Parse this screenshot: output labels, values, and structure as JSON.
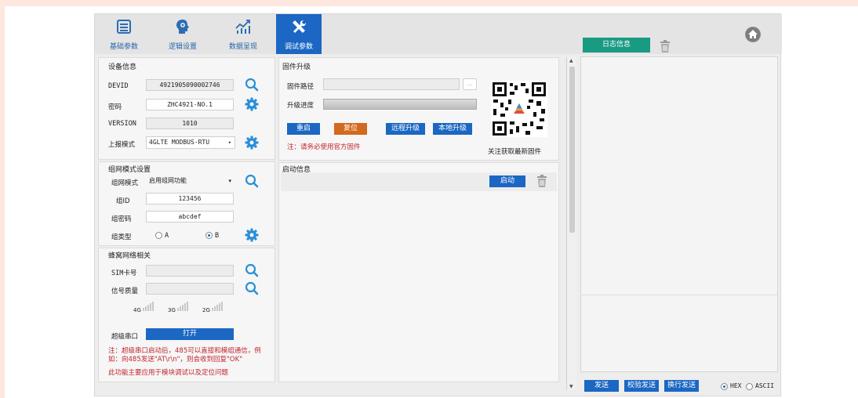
{
  "toolbar": {
    "items": [
      {
        "label": "基础参数",
        "icon": "list-icon"
      },
      {
        "label": "逻辑设置",
        "icon": "gear-brain-icon"
      },
      {
        "label": "数据呈现",
        "icon": "chart-icon"
      },
      {
        "label": "调试参数",
        "icon": "tools-icon"
      }
    ],
    "active_index": 3
  },
  "device_info": {
    "title": "设备信息",
    "devid_label": "DEVID",
    "devid_value": "4921905090002746",
    "password_label": "密码",
    "password_value": "ZHC4921-NO.1",
    "version_label": "VERSION",
    "version_value": "1010",
    "report_mode_label": "上报模式",
    "report_mode_value": "4GLTE  MODBUS-RTU"
  },
  "network_mode": {
    "title": "组网模式设置",
    "mode_label": "组网模式",
    "mode_value": "启用组网功能",
    "group_id_label": "组ID",
    "group_id_value": "123456",
    "group_pwd_label": "组密码",
    "group_pwd_value": "abcdef",
    "group_type_label": "组类型",
    "option_a": "A",
    "option_b": "B",
    "selected": "B"
  },
  "cellular": {
    "title": "蜂窝网络相关",
    "sim_label": "SIM卡号",
    "sim_value": "",
    "signal_label": "信号质量",
    "signal_value": "",
    "net_4g": "4G",
    "net_3g": "3G",
    "net_2g": "2G",
    "super_serial_label": "超级串口",
    "super_serial_button": "打开",
    "note": "注：超级串口启动后，485可以直接和模组通信，例如：向485发送\"AT\\r\\n\"，则会收到回复\"OK\"",
    "purpose": "此功能主要应用于模块调试以及定位问题"
  },
  "firmware": {
    "title": "固件升级",
    "path_label": "固件路径",
    "path_value": "",
    "browse_label": "....",
    "progress_label": "升级进度",
    "progress": 0,
    "buttons": {
      "restart": "重启",
      "reset": "复位",
      "remote_upgrade": "远程升级",
      "local_upgrade": "本地升级"
    },
    "note": "注：请务必使用官方固件",
    "qr_caption": "关注获取最新固件"
  },
  "startup": {
    "title": "启动信息",
    "start_button": "启动"
  },
  "log": {
    "tab_label": "日志信息",
    "send": "发送",
    "check_send": "校验发送",
    "newline_send": "换行发送",
    "hex": "HEX",
    "ascii": "ASCII",
    "format_selected": "HEX"
  },
  "colors": {
    "accent": "#1b67c3",
    "log_tab": "#199a82",
    "orange": "#d2691e",
    "note_red": "#c0262d",
    "gear_blue": "#2a8fd6"
  }
}
